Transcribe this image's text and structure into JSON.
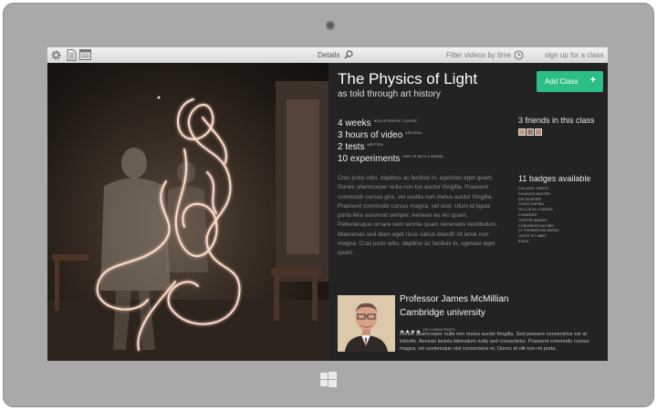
{
  "toolbar": {
    "details_label": "Details",
    "filter_label": "Filter videos by time",
    "signup_label": "sign up for a class"
  },
  "course": {
    "title": "The Physics of Light",
    "subtitle": "as told through art history",
    "add_button": "Add Class",
    "add_icon": "+"
  },
  "stats": [
    {
      "value": "4 weeks",
      "note": "non-intensive course"
    },
    {
      "value": "3 hours of video",
      "note": "archival"
    },
    {
      "value": "2 tests",
      "note": "written"
    },
    {
      "value": "10 experiments",
      "note": "pair up with a friend"
    }
  ],
  "friends": {
    "label": "3 friends in this class",
    "avatar_colors": [
      "#c79a7a",
      "#9a7b69",
      "#b88d78"
    ]
  },
  "description": "Cras justo odio, dapibus ac facilisis in, egetstas eget quam. Donec ullamcorper nulla non tus auctor fringilla. Praesent commodo cursus gna, vel scellla non metus auctor fringilla. Praesent commodo cursus magna, vel scel. Ulum id ligula porta felis euismod semper. Aenean eu leo quam. Pellentesque ornare sem lacinia quam venenatis vestibulum. Maecenas sed diam eget risus varius blandit sit amet non magna. Cras justo odio, dapibus ac facilisis in, egestas eget quam.",
  "badges": {
    "label": "11 badges available",
    "items": [
      "College Credit",
      "Doubles Master",
      "Dip Whipper",
      "Fusce Dapibu",
      "Tellus Ac Cursus",
      "Commodo",
      "Tortor Mauris",
      "Condimentum Nibh",
      "Ut Fermentum Massa",
      "Justo Sit Amet",
      "Risus"
    ]
  },
  "professor": {
    "name": "Professor James McMillian",
    "university": "Cambridge university",
    "stars": "★★★★",
    "karma": "2301 karma points",
    "bio": "Donec ullamcorper nulla non metus auctor fringilla. Sed posuere consectetur est at lobortis. Aenean lacinia bibendum nulla sed consectetur. Praesent commodo cursus magna, vel scelerisque nisl consectetur et. Donec id elit non mi porta."
  },
  "colors": {
    "accent": "#2bbf86",
    "panel": "#232323",
    "bezel": "#a9a9ab"
  }
}
